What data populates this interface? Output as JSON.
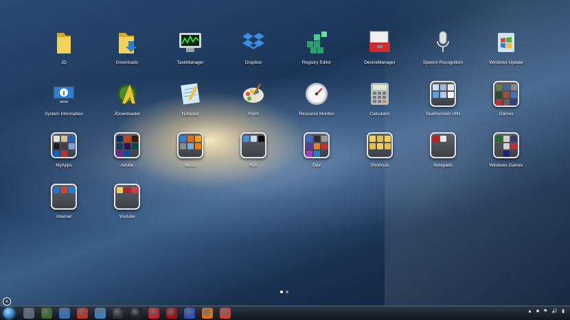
{
  "apps": [
    {
      "label": "JD",
      "icon": "folder-icon",
      "kind": "folder-yellow"
    },
    {
      "label": "Downloads",
      "icon": "downloads-folder-icon",
      "kind": "folder-download"
    },
    {
      "label": "TaskManager",
      "icon": "task-manager-icon",
      "kind": "monitor"
    },
    {
      "label": "Dropbox",
      "icon": "dropbox-icon",
      "kind": "dropbox"
    },
    {
      "label": "Registry Editor",
      "icon": "registry-editor-icon",
      "kind": "registry"
    },
    {
      "label": "DeviceManager",
      "icon": "device-manager-icon",
      "kind": "toolbox"
    },
    {
      "label": "Speech Recognition",
      "icon": "microphone-icon",
      "kind": "mic"
    },
    {
      "label": "Windows Update",
      "icon": "windows-update-icon",
      "kind": "winupdate"
    },
    {
      "label": "System Information",
      "icon": "system-information-icon",
      "kind": "sysinfo"
    },
    {
      "label": "JDownloader",
      "icon": "jdownloader-icon",
      "kind": "jdl"
    },
    {
      "label": "Notepad",
      "icon": "notepad-icon",
      "kind": "notepad"
    },
    {
      "label": "Paint",
      "icon": "paint-palette-icon",
      "kind": "paint"
    },
    {
      "label": "Resource Monitor",
      "icon": "resource-monitor-icon",
      "kind": "gauge"
    },
    {
      "label": "Calculator",
      "icon": "calculator-icon",
      "kind": "calc"
    },
    {
      "label": "Touchscreen Utils",
      "icon": "app-folder-icon",
      "kind": "group",
      "minis": [
        "#c8d8f0",
        "#9ab8e0",
        "#e6e6e6",
        "#5aa0e0",
        "#b0c8e8",
        "#ffffff"
      ]
    },
    {
      "label": "Games",
      "icon": "app-folder-icon",
      "kind": "group",
      "minis": [
        "#6a7a3a",
        "#3a6aa0",
        "#888888",
        "#2a4a2a",
        "#a05030",
        "#4a70c0",
        "#c03030",
        "#606060",
        "#304080"
      ]
    },
    {
      "label": "MyApps",
      "icon": "app-folder-icon",
      "kind": "group",
      "minis": [
        "#e0e0e0",
        "#d8c090",
        "#2060c0",
        "#202020",
        "#404040",
        "#80a0e0",
        "#1060c0",
        "#c03030"
      ]
    },
    {
      "label": "Adobe",
      "icon": "app-folder-icon",
      "kind": "group",
      "minis": [
        "#0a2a5a",
        "#d04010",
        "#3a1a00",
        "#1a3a5a",
        "#3a0a50",
        "#004a4a",
        "#6a2a8a",
        "#0050a0"
      ]
    },
    {
      "label": "Music",
      "icon": "app-folder-icon",
      "kind": "group",
      "minis": [
        "#3a80d0",
        "#e07010",
        "#f0a020",
        "#8a8a8a",
        "#6ab0e0",
        "#f08000"
      ]
    },
    {
      "label": "Run",
      "icon": "app-folder-icon",
      "kind": "group",
      "minis": [
        "#4a90d0",
        "#c8dcf0",
        "#101010"
      ]
    },
    {
      "label": "Dev",
      "icon": "app-folder-icon",
      "kind": "group",
      "minis": [
        "#3a6ad0",
        "#303030",
        "#9a9a9a",
        "#5a3a90",
        "#e08020",
        "#c03030",
        "#a040c0",
        "#2080c0"
      ]
    },
    {
      "label": "Shortcuts",
      "icon": "app-folder-icon",
      "kind": "group",
      "minis": [
        "#f0d060",
        "#e0c050",
        "#f0d060",
        "#e0c050",
        "#f0d060",
        "#e0c050"
      ]
    },
    {
      "label": "Notepads",
      "icon": "app-folder-icon",
      "kind": "group",
      "minis": [
        "#c02020",
        "#e8e8e8"
      ]
    },
    {
      "label": "Windows Games",
      "icon": "app-folder-icon",
      "kind": "group",
      "minis": [
        "#2a6a2a",
        "#d0d0d0",
        "#3a3a6a",
        "#505050",
        "#d0d0d0",
        "#c03030",
        "#4a4a4a",
        "#202080"
      ]
    },
    {
      "label": "Internet",
      "icon": "app-folder-icon",
      "kind": "group",
      "minis": [
        "#2a70d0",
        "#e04020",
        "#1a80e0"
      ]
    },
    {
      "label": "Youtube",
      "icon": "app-folder-icon",
      "kind": "group",
      "minis": [
        "#f0d060",
        "#c02020",
        "#d04040"
      ]
    }
  ],
  "taskbar": {
    "items": [
      {
        "icon": "photo-viewer-icon",
        "color": "#556677"
      },
      {
        "icon": "jdownloader-icon",
        "color": "#3a6a20"
      },
      {
        "icon": "windows-logo-icon",
        "color": "#2a70c0"
      },
      {
        "icon": "flash-icon",
        "color": "#c03020"
      },
      {
        "icon": "ie-icon",
        "color": "#3a80c0"
      },
      {
        "icon": "film-icon",
        "color": "#303030"
      },
      {
        "icon": "penguin-icon",
        "color": "#222222"
      },
      {
        "icon": "youtube-icon",
        "color": "#c02020"
      },
      {
        "icon": "media-record-icon",
        "color": "#a01010"
      },
      {
        "icon": "arrow-app-icon",
        "color": "#2a50c0"
      },
      {
        "icon": "vlc-icon",
        "color": "#e07010"
      },
      {
        "icon": "chrome-icon",
        "color": "#d04030"
      }
    ]
  },
  "tray": {
    "items": [
      "▲",
      "■",
      "⚑",
      "🔊",
      "▮"
    ]
  }
}
